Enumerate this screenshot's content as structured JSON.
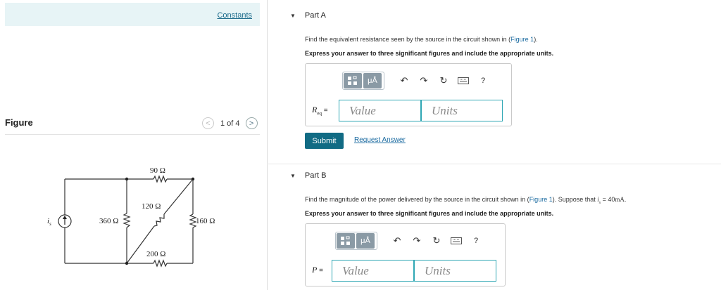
{
  "left": {
    "constants_link": "Constants",
    "figure_label": "Figure",
    "pager": {
      "count": "1 of 4",
      "prev_glyph": "<",
      "next_glyph": ">"
    },
    "circuit": {
      "source_label": "i",
      "source_sub": "s",
      "r360": "360 Ω",
      "r90": "90 Ω",
      "r120": "120 Ω",
      "r160": "160 Ω",
      "r200": "200 Ω"
    }
  },
  "partA": {
    "title": "Part A",
    "prompt_before": "Find the equivalent resistance seen by the source in the circuit shown in (",
    "figure_link": "Figure 1",
    "prompt_after": ").",
    "instruction": "Express your answer to three significant figures and include the appropriate units.",
    "eq_label_main": "R",
    "eq_label_sub": "eq",
    "eq_sign": " =",
    "value_placeholder": "Value",
    "units_placeholder": "Units",
    "submit_label": "Submit",
    "request_label": "Request Answer"
  },
  "partB": {
    "title": "Part B",
    "prompt_before": "Find the magnitude of the power delivered by the source in the circuit shown in (",
    "figure_link": "Figure 1",
    "prompt_after": "). Suppose that ",
    "condition_var": "i",
    "condition_sub": "s",
    "condition_eq": " = 40",
    "condition_unit": "mA",
    "condition_end": ".",
    "instruction": "Express your answer to three significant figures and include the appropriate units.",
    "eq_label_main": "P",
    "eq_sign": " =",
    "value_placeholder": "Value",
    "units_placeholder": "Units"
  },
  "toolbar": {
    "mu_label": "μÅ",
    "help_label": "?",
    "icons": [
      "templates-icon",
      "symbols-icon",
      "undo-icon",
      "redo-icon",
      "reset-icon",
      "keyboard-icon",
      "help-icon"
    ]
  },
  "colors": {
    "accent": "#116b84",
    "input_border": "#2fa7b4",
    "link": "#1a6aa0",
    "constants_bg": "#e7f4f6"
  }
}
